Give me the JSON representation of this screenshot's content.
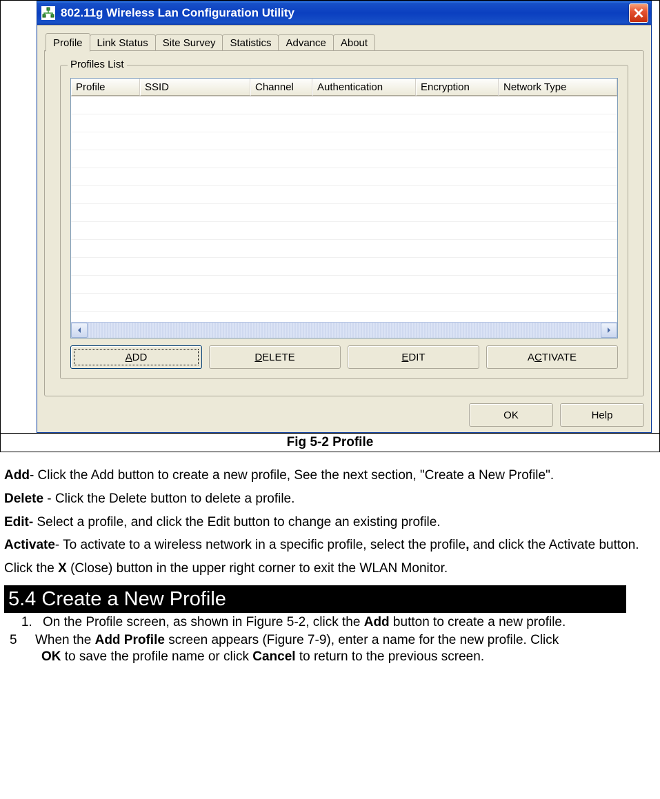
{
  "window": {
    "title": "802.11g Wireless Lan Configuration Utility"
  },
  "tabs": [
    "Profile",
    "Link Status",
    "Site Survey",
    "Statistics",
    "Advance",
    "About"
  ],
  "groupbox_label": "Profiles List",
  "columns": [
    "Profile",
    "SSID",
    "Channel",
    "Authentication",
    "Encryption",
    "Network Type"
  ],
  "buttons": {
    "add": "ADD",
    "delete": "DELETE",
    "edit": "EDIT",
    "activate": "ACTIVATE",
    "ok": "OK",
    "help": "Help"
  },
  "caption": "Fig 5-2 Profile",
  "doc": {
    "add_label": "Add",
    "add_text": "- Click the Add button to create a new profile, See the next section, \"Create a New Profile\".",
    "delete_label": "Delete",
    "delete_text": " - Click the Delete button to delete a profile.",
    "edit_label": "Edit-",
    "edit_text": " Select a profile, and click the Edit button to change an existing profile.",
    "activate_label": "Activate",
    "activate_text_a": "- To activate to a wireless network in a specific profile, select the profile",
    "activate_text_b": " and click the Activate button.",
    "close_text_a": "Click the ",
    "close_bold": "X",
    "close_text_b": " (Close) button in the upper right corner to exit the WLAN Monitor.",
    "section": "5.4 Create a New Profile",
    "step1_a": "On the Profile screen, as shown in Figure 5-2, click the ",
    "step1_bold": "Add",
    "step1_b": " button to create a new profile.",
    "step2_num": "5",
    "step2_a": "When the ",
    "step2_bold1": "Add Profile",
    "step2_b": " screen appears (Figure 7-9), enter a name for the new profile. Click ",
    "step2_bold2": "OK",
    "step2_c": " to save the profile name or click ",
    "step2_bold3": "Cancel",
    "step2_d": " to return to the previous screen."
  }
}
